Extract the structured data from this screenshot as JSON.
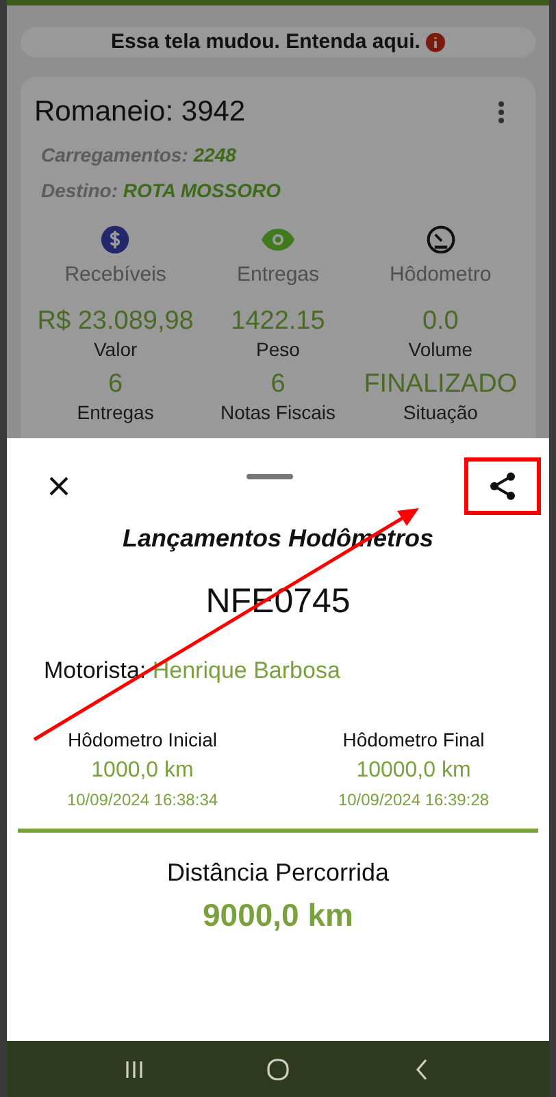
{
  "banner": {
    "text": "Essa tela mudou. Entenda aqui."
  },
  "card": {
    "title": "Romaneio: 3942",
    "details": [
      {
        "label": "Carregamentos:",
        "value": "2248"
      },
      {
        "label": "Destino:",
        "value": "ROTA MOSSORO"
      }
    ],
    "actions": [
      {
        "kind": "money",
        "label": "Recebíveis"
      },
      {
        "kind": "eye",
        "label": "Entregas"
      },
      {
        "kind": "gauge",
        "label": "Hôdometro"
      }
    ],
    "stats": [
      {
        "value": "R$ 23.089,98",
        "label": "Valor"
      },
      {
        "value": "1422.15",
        "label": "Peso"
      },
      {
        "value": "0.0",
        "label": "Volume"
      },
      {
        "value": "6",
        "label": "Entregas"
      },
      {
        "value": "6",
        "label": "Notas Fiscais"
      },
      {
        "value": "FINALIZADO",
        "label": "Situação"
      }
    ]
  },
  "sheet": {
    "title": "Lançamentos Hodômetros",
    "document": "NFE0745",
    "driver_label": "Motorista:",
    "driver": "Henrique Barbosa",
    "readings": [
      {
        "label": "Hôdometro Inicial",
        "value": "1000,0 km",
        "time": "10/09/2024 16:38:34"
      },
      {
        "label": "Hôdometro Final",
        "value": "10000,0 km",
        "time": "10/09/2024 16:39:28"
      }
    ],
    "distance_label": "Distância Percorrida",
    "distance": "9000,0 km"
  },
  "annotation": {
    "highlight": true,
    "arrow": true
  },
  "nav_bar": [
    {
      "kind": "recents"
    },
    {
      "kind": "home"
    },
    {
      "kind": "back"
    }
  ]
}
